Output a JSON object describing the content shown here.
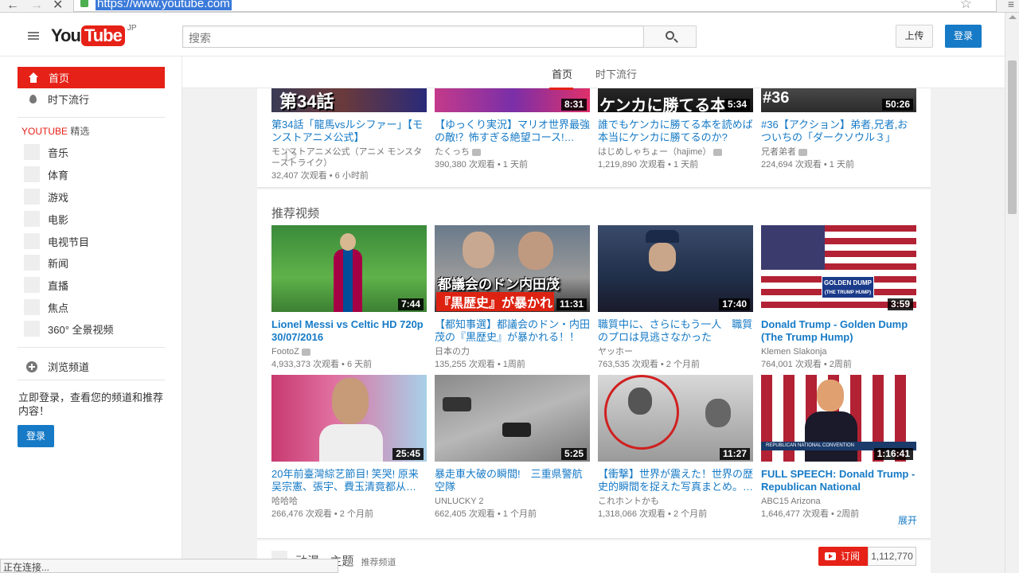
{
  "browser": {
    "url": "https://www.youtube.com",
    "status": "正在连接..."
  },
  "header": {
    "logo_you": "You",
    "logo_tube": "Tube",
    "logo_region": "JP",
    "search_placeholder": "搜索",
    "upload_label": "上传",
    "signin_label": "登录"
  },
  "sidebar": {
    "items": [
      {
        "label": "首页"
      },
      {
        "label": "时下流行"
      }
    ],
    "section_youtube": "YOUTUBE",
    "section_featured": "精选",
    "channels": [
      {
        "label": "音乐"
      },
      {
        "label": "体育"
      },
      {
        "label": "游戏"
      },
      {
        "label": "电影"
      },
      {
        "label": "电视节目"
      },
      {
        "label": "新闻"
      },
      {
        "label": "直播"
      },
      {
        "label": "焦点"
      },
      {
        "label": "360° 全景视频"
      }
    ],
    "browse_channels": "浏览频道",
    "signin_note": "立即登录，查看您的频道和推荐内容！",
    "signin_button": "登录"
  },
  "tabs": [
    {
      "label": "首页"
    },
    {
      "label": "时下流行"
    }
  ],
  "top_row": [
    {
      "thumb_text": "第34話",
      "duration": "",
      "title": "第34話「龍馬vsルシファー」【モンストアニメ公式】",
      "channel": "モンストアニメ公式（アニメ モンスターストライク）",
      "meta": "32,407 次观看 • 6 小时前"
    },
    {
      "thumb_text": "",
      "duration": "8:31",
      "title": "【ゆっくり実況】マリオ世界最強の敵!？怖すぎる絶望コース!…",
      "channel": "たくっち",
      "meta": "390,380 次观看 • 1 天前"
    },
    {
      "thumb_text": "ケンカに勝てる本",
      "duration": "5:34",
      "title": "誰でもケンカに勝てる本を読めば本当にケンカに勝てるのか?",
      "channel": "はじめしゃちょー（hajime）",
      "meta": "1,219,890 次观看 • 1 天前"
    },
    {
      "thumb_text": "#36",
      "duration": "50:26",
      "title": "#36【アクション】弟者,兄者,おついちの「ダークソウル３」",
      "channel": "兄者弟者",
      "meta": "224,694 次观看 • 1 天前"
    }
  ],
  "recommended": {
    "title": "推荐视频",
    "expand": "展开",
    "videos": [
      {
        "duration": "7:44",
        "title": "Lionel Messi vs Celtic HD 720p 30/07/2016",
        "bold": true,
        "channel": "FootoZ",
        "verified": true,
        "meta": "4,933,373 次观看 • 6 天前"
      },
      {
        "duration": "11:31",
        "title": "【都知事選】都議会のドン・内田茂の『黒歴史』が暴かれる！！",
        "bold": false,
        "channel": "日本の力",
        "verified": false,
        "meta": "135,255 次观看 • 1周前"
      },
      {
        "duration": "17:40",
        "title": "職質中に、さらにもう一人　職質のプロは見逃さなかった",
        "bold": false,
        "channel": "ヤッホー",
        "verified": false,
        "meta": "763,535 次观看 • 2 个月前"
      },
      {
        "duration": "3:59",
        "title": "Donald Trump - Golden Dump (The Trump Hump)",
        "bold": true,
        "channel": "Klemen Slakonja",
        "verified": false,
        "meta": "764,001 次观看 • 2周前"
      },
      {
        "duration": "25:45",
        "title": "20年前臺灣綜艺節目! 笑哭! 原来吴宗憲、張宇、費玉清竟都从…",
        "bold": false,
        "channel": "哈哈哈",
        "verified": false,
        "meta": "266,476 次观看 • 2 个月前"
      },
      {
        "duration": "5:25",
        "title": "暴走車大破の瞬間!　三重県警航空隊",
        "bold": false,
        "channel": "UNLUCKY 2",
        "verified": false,
        "meta": "662,405 次观看 • 1 个月前"
      },
      {
        "duration": "11:27",
        "title": "【衝撃】世界が震えた！世界の歴史的瞬間を捉えた写真まとめ。…",
        "bold": false,
        "channel": "これホントかも",
        "verified": false,
        "meta": "1,318,066 次观看 • 2 个月前"
      },
      {
        "duration": "1:16:41",
        "title": "FULL SPEECH: Donald Trump - Republican National Convention…",
        "bold": true,
        "channel": "ABC15 Arizona",
        "verified": false,
        "meta": "1,646,477 次观看 • 2周前"
      }
    ],
    "thumb_texts": {
      "donald": "GOLDEN DUMP",
      "donald_sub": "(THE TRUMP HUMP)",
      "uchida1": "都議会のドン内田茂",
      "uchida2": "『黒歴史』が暴かれ",
      "rnc": "REPUBLICAN NATIONAL CONVENTION"
    }
  },
  "next_section": {
    "title": "动漫 - 主题",
    "subtitle": "推荐频道",
    "subscribe": "订阅",
    "count": "1,112,770"
  }
}
